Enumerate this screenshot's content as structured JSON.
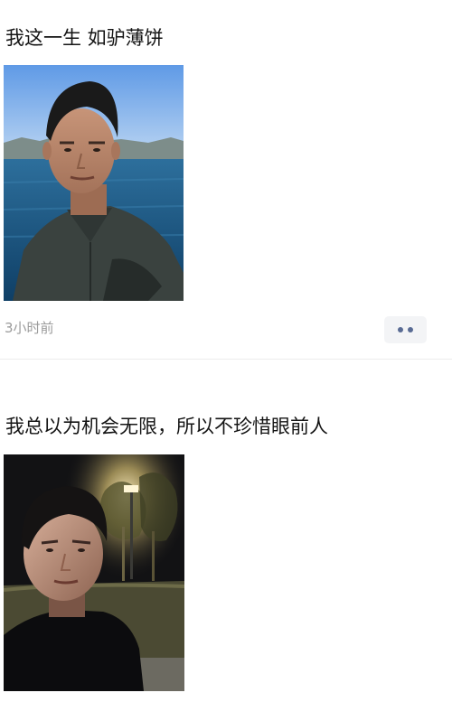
{
  "feed": {
    "posts": [
      {
        "text": "我这一生 如驴薄饼",
        "timestamp": "3小时前",
        "photo": "selfie-by-lake"
      },
      {
        "text": "我总以为机会无限，所以不珍惜眼前人",
        "photo": "selfie-at-night-park"
      }
    ]
  },
  "colors": {
    "text": "#141414",
    "timestamp": "#9b9b9b",
    "more_button_bg": "#f3f4f6",
    "more_button_dots": "#596b94",
    "divider": "#ececec"
  }
}
